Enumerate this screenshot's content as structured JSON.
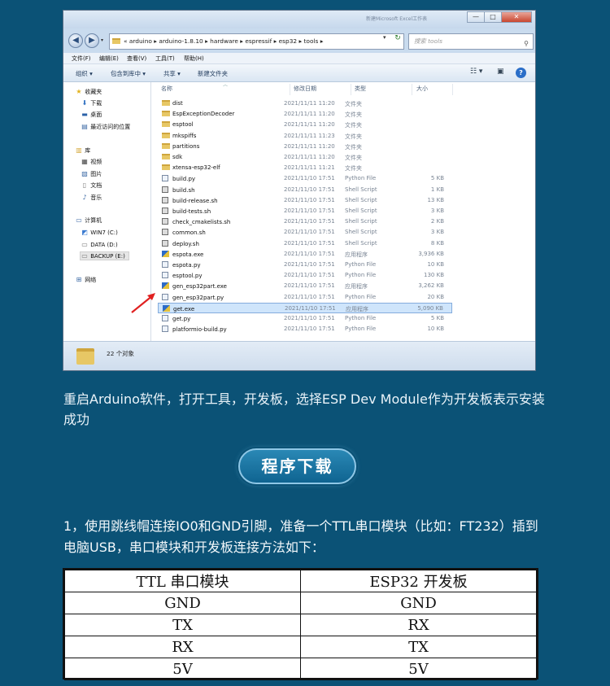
{
  "window": {
    "title_faint": "新建Microsoft Excel工作表",
    "buttons": {
      "minimize": "—",
      "maximize": "□",
      "close": "✕"
    },
    "address": {
      "segments": [
        "«",
        "arduino",
        "arduino-1.8.10",
        "hardware",
        "espressif",
        "esp32",
        "tools"
      ],
      "path_text": "«  arduino  ▸  arduino-1.8.10  ▸  hardware  ▸  espressif  ▸  esp32  ▸  tools  ▸"
    },
    "search_placeholder": "搜索 tools",
    "menu": [
      "文件(F)",
      "编辑(E)",
      "查看(V)",
      "工具(T)",
      "帮助(H)"
    ],
    "commands": [
      "组织 ▾",
      "包含到库中 ▾",
      "共享 ▾",
      "新建文件夹"
    ],
    "nav": {
      "favorites": "收藏夹",
      "downloads": "下载",
      "desktop": "桌面",
      "recent": "最近访问的位置",
      "libraries": "库",
      "videos": "视频",
      "pictures": "图片",
      "documents": "文档",
      "music": "音乐",
      "computer": "计算机",
      "drive_c": "WIN7 (C:)",
      "drive_d": "DATA (D:)",
      "drive_e": "BACKUP (E:)",
      "network": "网络"
    },
    "columns": {
      "name": "名称",
      "date": "修改日期",
      "type": "类型",
      "size": "大小"
    },
    "files": [
      {
        "name": "dist",
        "date": "2021/11/11 11:20",
        "type": "文件夹",
        "size": "",
        "icon": "folder"
      },
      {
        "name": "EspExceptionDecoder",
        "date": "2021/11/11 11:20",
        "type": "文件夹",
        "size": "",
        "icon": "folder"
      },
      {
        "name": "esptool",
        "date": "2021/11/11 11:20",
        "type": "文件夹",
        "size": "",
        "icon": "folder"
      },
      {
        "name": "mkspiffs",
        "date": "2021/11/11 11:23",
        "type": "文件夹",
        "size": "",
        "icon": "folder"
      },
      {
        "name": "partitions",
        "date": "2021/11/11 11:20",
        "type": "文件夹",
        "size": "",
        "icon": "folder"
      },
      {
        "name": "sdk",
        "date": "2021/11/11 11:20",
        "type": "文件夹",
        "size": "",
        "icon": "folder"
      },
      {
        "name": "xtensa-esp32-elf",
        "date": "2021/11/11 11:21",
        "type": "文件夹",
        "size": "",
        "icon": "folder"
      },
      {
        "name": "build.py",
        "date": "2021/11/10 17:51",
        "type": "Python File",
        "size": "5 KB",
        "icon": "py"
      },
      {
        "name": "build.sh",
        "date": "2021/11/10 17:51",
        "type": "Shell Script",
        "size": "1 KB",
        "icon": "sh"
      },
      {
        "name": "build-release.sh",
        "date": "2021/11/10 17:51",
        "type": "Shell Script",
        "size": "13 KB",
        "icon": "sh"
      },
      {
        "name": "build-tests.sh",
        "date": "2021/11/10 17:51",
        "type": "Shell Script",
        "size": "3 KB",
        "icon": "sh"
      },
      {
        "name": "check_cmakelists.sh",
        "date": "2021/11/10 17:51",
        "type": "Shell Script",
        "size": "2 KB",
        "icon": "sh"
      },
      {
        "name": "common.sh",
        "date": "2021/11/10 17:51",
        "type": "Shell Script",
        "size": "3 KB",
        "icon": "sh"
      },
      {
        "name": "deploy.sh",
        "date": "2021/11/10 17:51",
        "type": "Shell Script",
        "size": "8 KB",
        "icon": "sh"
      },
      {
        "name": "espota.exe",
        "date": "2021/11/10 17:51",
        "type": "应用程序",
        "size": "3,936 KB",
        "icon": "exe"
      },
      {
        "name": "espota.py",
        "date": "2021/11/10 17:51",
        "type": "Python File",
        "size": "10 KB",
        "icon": "py"
      },
      {
        "name": "esptool.py",
        "date": "2021/11/10 17:51",
        "type": "Python File",
        "size": "130 KB",
        "icon": "py"
      },
      {
        "name": "gen_esp32part.exe",
        "date": "2021/11/10 17:51",
        "type": "应用程序",
        "size": "3,262 KB",
        "icon": "exe"
      },
      {
        "name": "gen_esp32part.py",
        "date": "2021/11/10 17:51",
        "type": "Python File",
        "size": "20 KB",
        "icon": "py"
      },
      {
        "name": "get.exe",
        "date": "2021/11/10 17:51",
        "type": "应用程序",
        "size": "5,090 KB",
        "icon": "exe",
        "selected": true
      },
      {
        "name": "get.py",
        "date": "2021/11/10 17:51",
        "type": "Python File",
        "size": "5 KB",
        "icon": "py"
      },
      {
        "name": "platformio-build.py",
        "date": "2021/11/10 17:51",
        "type": "Python File",
        "size": "10 KB",
        "icon": "py"
      }
    ],
    "status": "22 个对象"
  },
  "caption": "重启Arduino软件，打开工具，开发板，选择ESP Dev Module作为开发板表示安装成功",
  "section_title": "程序下载",
  "instruction": "1，使用跳线帽连接IO0和GND引脚，准备一个TTL串口模块（比如：FT232）插到电脑USB，串口模块和开发板连接方法如下：",
  "table": {
    "headers": [
      "TTL 串口模块",
      "ESP32 开发板"
    ],
    "rows": [
      [
        "GND",
        "GND"
      ],
      [
        "TX",
        "RX"
      ],
      [
        "RX",
        "TX"
      ],
      [
        "5V",
        "5V"
      ]
    ]
  },
  "colors": {
    "background": "#0b5276",
    "selection": "#cfe5fb",
    "arrow": "#e02020"
  }
}
